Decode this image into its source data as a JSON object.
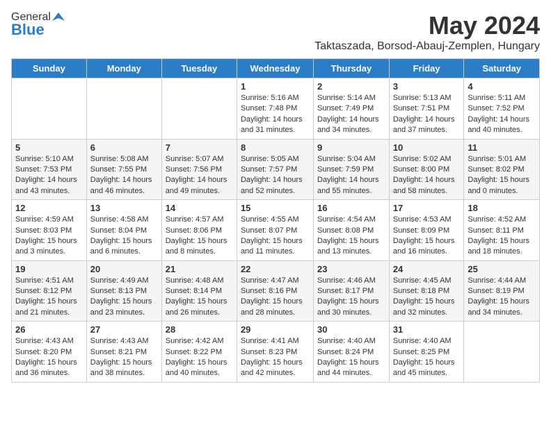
{
  "header": {
    "logo_general": "General",
    "logo_blue": "Blue",
    "month_title": "May 2024",
    "location": "Taktaszada, Borsod-Abauj-Zemplen, Hungary"
  },
  "weekdays": [
    "Sunday",
    "Monday",
    "Tuesday",
    "Wednesday",
    "Thursday",
    "Friday",
    "Saturday"
  ],
  "weeks": [
    [
      {
        "day": "",
        "info": ""
      },
      {
        "day": "",
        "info": ""
      },
      {
        "day": "",
        "info": ""
      },
      {
        "day": "1",
        "info": "Sunrise: 5:16 AM\nSunset: 7:48 PM\nDaylight: 14 hours\nand 31 minutes."
      },
      {
        "day": "2",
        "info": "Sunrise: 5:14 AM\nSunset: 7:49 PM\nDaylight: 14 hours\nand 34 minutes."
      },
      {
        "day": "3",
        "info": "Sunrise: 5:13 AM\nSunset: 7:51 PM\nDaylight: 14 hours\nand 37 minutes."
      },
      {
        "day": "4",
        "info": "Sunrise: 5:11 AM\nSunset: 7:52 PM\nDaylight: 14 hours\nand 40 minutes."
      }
    ],
    [
      {
        "day": "5",
        "info": "Sunrise: 5:10 AM\nSunset: 7:53 PM\nDaylight: 14 hours\nand 43 minutes."
      },
      {
        "day": "6",
        "info": "Sunrise: 5:08 AM\nSunset: 7:55 PM\nDaylight: 14 hours\nand 46 minutes."
      },
      {
        "day": "7",
        "info": "Sunrise: 5:07 AM\nSunset: 7:56 PM\nDaylight: 14 hours\nand 49 minutes."
      },
      {
        "day": "8",
        "info": "Sunrise: 5:05 AM\nSunset: 7:57 PM\nDaylight: 14 hours\nand 52 minutes."
      },
      {
        "day": "9",
        "info": "Sunrise: 5:04 AM\nSunset: 7:59 PM\nDaylight: 14 hours\nand 55 minutes."
      },
      {
        "day": "10",
        "info": "Sunrise: 5:02 AM\nSunset: 8:00 PM\nDaylight: 14 hours\nand 58 minutes."
      },
      {
        "day": "11",
        "info": "Sunrise: 5:01 AM\nSunset: 8:02 PM\nDaylight: 15 hours\nand 0 minutes."
      }
    ],
    [
      {
        "day": "12",
        "info": "Sunrise: 4:59 AM\nSunset: 8:03 PM\nDaylight: 15 hours\nand 3 minutes."
      },
      {
        "day": "13",
        "info": "Sunrise: 4:58 AM\nSunset: 8:04 PM\nDaylight: 15 hours\nand 6 minutes."
      },
      {
        "day": "14",
        "info": "Sunrise: 4:57 AM\nSunset: 8:06 PM\nDaylight: 15 hours\nand 8 minutes."
      },
      {
        "day": "15",
        "info": "Sunrise: 4:55 AM\nSunset: 8:07 PM\nDaylight: 15 hours\nand 11 minutes."
      },
      {
        "day": "16",
        "info": "Sunrise: 4:54 AM\nSunset: 8:08 PM\nDaylight: 15 hours\nand 13 minutes."
      },
      {
        "day": "17",
        "info": "Sunrise: 4:53 AM\nSunset: 8:09 PM\nDaylight: 15 hours\nand 16 minutes."
      },
      {
        "day": "18",
        "info": "Sunrise: 4:52 AM\nSunset: 8:11 PM\nDaylight: 15 hours\nand 18 minutes."
      }
    ],
    [
      {
        "day": "19",
        "info": "Sunrise: 4:51 AM\nSunset: 8:12 PM\nDaylight: 15 hours\nand 21 minutes."
      },
      {
        "day": "20",
        "info": "Sunrise: 4:49 AM\nSunset: 8:13 PM\nDaylight: 15 hours\nand 23 minutes."
      },
      {
        "day": "21",
        "info": "Sunrise: 4:48 AM\nSunset: 8:14 PM\nDaylight: 15 hours\nand 26 minutes."
      },
      {
        "day": "22",
        "info": "Sunrise: 4:47 AM\nSunset: 8:16 PM\nDaylight: 15 hours\nand 28 minutes."
      },
      {
        "day": "23",
        "info": "Sunrise: 4:46 AM\nSunset: 8:17 PM\nDaylight: 15 hours\nand 30 minutes."
      },
      {
        "day": "24",
        "info": "Sunrise: 4:45 AM\nSunset: 8:18 PM\nDaylight: 15 hours\nand 32 minutes."
      },
      {
        "day": "25",
        "info": "Sunrise: 4:44 AM\nSunset: 8:19 PM\nDaylight: 15 hours\nand 34 minutes."
      }
    ],
    [
      {
        "day": "26",
        "info": "Sunrise: 4:43 AM\nSunset: 8:20 PM\nDaylight: 15 hours\nand 36 minutes."
      },
      {
        "day": "27",
        "info": "Sunrise: 4:43 AM\nSunset: 8:21 PM\nDaylight: 15 hours\nand 38 minutes."
      },
      {
        "day": "28",
        "info": "Sunrise: 4:42 AM\nSunset: 8:22 PM\nDaylight: 15 hours\nand 40 minutes."
      },
      {
        "day": "29",
        "info": "Sunrise: 4:41 AM\nSunset: 8:23 PM\nDaylight: 15 hours\nand 42 minutes."
      },
      {
        "day": "30",
        "info": "Sunrise: 4:40 AM\nSunset: 8:24 PM\nDaylight: 15 hours\nand 44 minutes."
      },
      {
        "day": "31",
        "info": "Sunrise: 4:40 AM\nSunset: 8:25 PM\nDaylight: 15 hours\nand 45 minutes."
      },
      {
        "day": "",
        "info": ""
      }
    ]
  ]
}
